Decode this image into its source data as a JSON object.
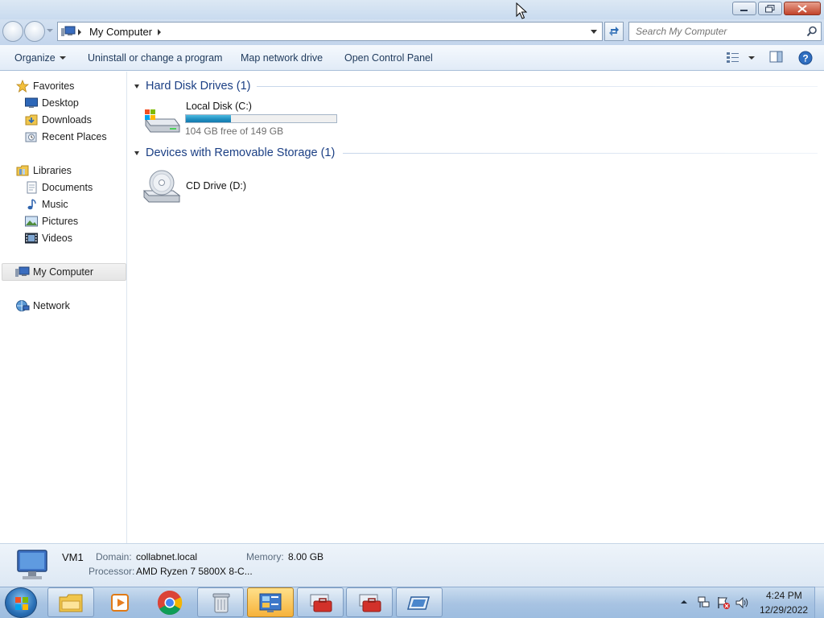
{
  "window": {
    "address": {
      "location": "My Computer"
    },
    "search": {
      "placeholder": "Search My Computer"
    }
  },
  "toolbar": {
    "organize_label": "Organize",
    "uninstall_label": "Uninstall or change a program",
    "map_drive_label": "Map network drive",
    "control_panel_label": "Open Control Panel"
  },
  "sidebar": {
    "favorites": {
      "label": "Favorites",
      "items": [
        {
          "label": "Desktop",
          "icon": "desktop-icon"
        },
        {
          "label": "Downloads",
          "icon": "downloads-folder-icon"
        },
        {
          "label": "Recent Places",
          "icon": "recent-places-icon"
        }
      ]
    },
    "libraries": {
      "label": "Libraries",
      "items": [
        {
          "label": "Documents",
          "icon": "documents-icon"
        },
        {
          "label": "Music",
          "icon": "music-icon"
        },
        {
          "label": "Pictures",
          "icon": "pictures-icon"
        },
        {
          "label": "Videos",
          "icon": "videos-icon"
        }
      ]
    },
    "computer": {
      "label": "My Computer",
      "selected": true
    },
    "network": {
      "label": "Network"
    }
  },
  "content": {
    "groups": [
      {
        "title": "Hard Disk Drives (1)",
        "drives": [
          {
            "name": "Local Disk (C:)",
            "free_text": "104 GB free of 149 GB",
            "used_fraction": 0.302
          }
        ]
      },
      {
        "title": "Devices with Removable Storage (1)",
        "drives": [
          {
            "name": "CD Drive (D:)"
          }
        ]
      }
    ]
  },
  "details": {
    "name": "VM1",
    "domain_label": "Domain:",
    "domain_value": "collabnet.local",
    "memory_label": "Memory:",
    "memory_value": "8.00 GB",
    "processor_label": "Processor:",
    "processor_value": "AMD Ryzen 7 5800X 8-C..."
  },
  "taskbar": {
    "apps": [
      "explorer-folder",
      "media-player",
      "chrome",
      "recycle-app",
      "control-panel",
      "toolbox-app",
      "toolbox-app-2",
      "remote-desktop"
    ],
    "active_app": "control-panel",
    "time": "4:24 PM",
    "date": "12/29/2022"
  },
  "colors": {
    "accent": "#1b3f84",
    "drive_fill": "#1f8dbf",
    "toolbar_text": "#1e395b"
  }
}
